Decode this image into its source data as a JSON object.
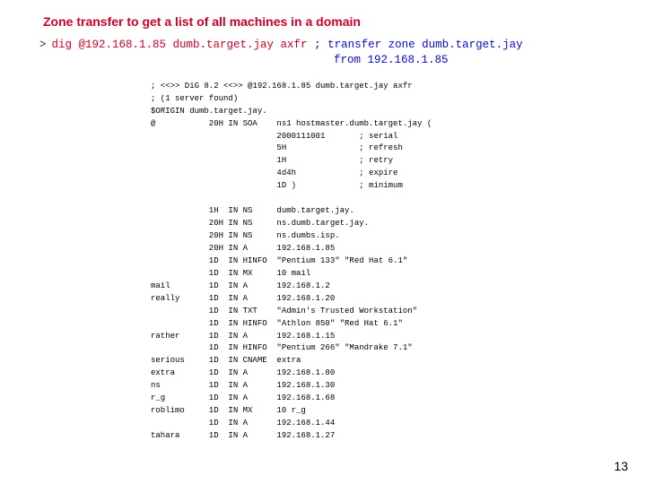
{
  "title": "Zone transfer to get a list of all machines in a domain",
  "prompt": ">",
  "cmd_left": "dig @192.168.1.85 dumb.target.jay axfr ",
  "cmd_right": "; transfer zone dumb.target.jay",
  "cmd_right2": "from 192.168.1.85",
  "zone": "; <<>> DiG 8.2 <<>> @192.168.1.85 dumb.target.jay axfr\n; (1 server found)\n$ORIGIN dumb.target.jay.\n@           20H IN SOA    ns1 hostmaster.dumb.target.jay (\n                          2000111001       ; serial\n                          5H               ; refresh\n                          1H               ; retry\n                          4d4h             ; expire\n                          1D )             ; minimum\n\n            1H  IN NS     dumb.target.jay.\n            20H IN NS     ns.dumb.target.jay.\n            20H IN NS     ns.dumbs.isp.\n            20H IN A      192.168.1.85\n            1D  IN HINFO  \"Pentium 133\" \"Red Hat 6.1\"\n            1D  IN MX     10 mail\nmail        1D  IN A      192.168.1.2\nreally      1D  IN A      192.168.1.20\n            1D  IN TXT    \"Admin's Trusted Workstation\"\n            1D  IN HINFO  \"Athlon 850\" \"Red Hat 6.1\"\nrather      1D  IN A      192.168.1.15\n            1D  IN HINFO  \"Pentium 266\" \"Mandrake 7.1\"\nserious     1D  IN CNAME  extra\nextra       1D  IN A      192.168.1.80\nns          1D  IN A      192.168.1.30\nr_g         1D  IN A      192.168.1.68\nroblimo     1D  IN MX     10 r_g\n            1D  IN A      192.168.1.44\ntahara      1D  IN A      192.168.1.27",
  "page_number": "13"
}
